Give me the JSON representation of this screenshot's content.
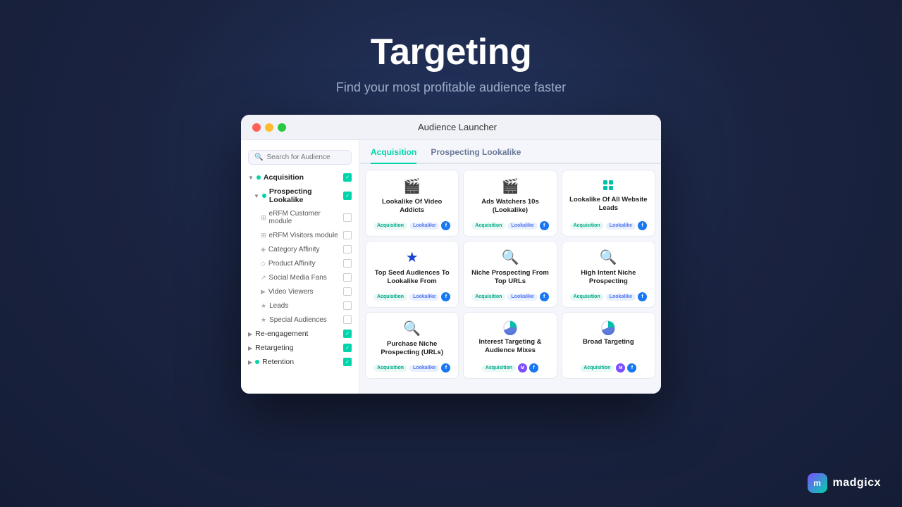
{
  "hero": {
    "title": "Targeting",
    "subtitle": "Find your most profitable audience faster"
  },
  "window": {
    "title": "Audience Launcher"
  },
  "search": {
    "placeholder": "Search for Audience"
  },
  "sidebar": {
    "items": [
      {
        "label": "Acquisition",
        "level": 0,
        "checked": true,
        "hasDot": true,
        "dotColor": "teal"
      },
      {
        "label": "Prospecting Lookalike",
        "level": 1,
        "checked": true,
        "hasDot": true,
        "dotColor": "teal"
      },
      {
        "label": "eRFM Customer module",
        "level": 2,
        "checked": false,
        "hasDot": true,
        "dotColor": "gray"
      },
      {
        "label": "eRFM Visitors module",
        "level": 2,
        "checked": false,
        "hasDot": true,
        "dotColor": "gray"
      },
      {
        "label": "Category Affinity",
        "level": 2,
        "checked": false,
        "hasDot": true,
        "dotColor": "gray"
      },
      {
        "label": "Product Affinity",
        "level": 2,
        "checked": false,
        "hasDot": true,
        "dotColor": "gray"
      },
      {
        "label": "Social Media Fans",
        "level": 2,
        "checked": false,
        "hasDot": true,
        "dotColor": "gray"
      },
      {
        "label": "Video Viewers",
        "level": 2,
        "checked": false,
        "hasDot": true,
        "dotColor": "gray"
      },
      {
        "label": "Leads",
        "level": 2,
        "checked": false,
        "hasDot": true,
        "dotColor": "gray"
      },
      {
        "label": "Special Audiences",
        "level": 2,
        "checked": false,
        "hasDot": true,
        "dotColor": "gray"
      },
      {
        "label": "Re-engagement",
        "level": 0,
        "checked": true,
        "hasDot": false,
        "collapsed": true
      },
      {
        "label": "Retargeting",
        "level": 0,
        "checked": true,
        "hasDot": false,
        "collapsed": true
      },
      {
        "label": "Retention",
        "level": 0,
        "checked": true,
        "hasDot": true,
        "dotColor": "teal",
        "collapsed": true
      }
    ]
  },
  "tabs": [
    {
      "label": "Acquisition",
      "active": true
    },
    {
      "label": "Prospecting Lookalike",
      "active": false
    }
  ],
  "cards": [
    {
      "icon": "video",
      "title": "Lookalike Of Video Addicts",
      "tags": [
        "Acquisition",
        "Lookalike"
      ],
      "hasFb": true
    },
    {
      "icon": "video",
      "title": "Ads Watchers 10s (Lookalike)",
      "tags": [
        "Acquisition",
        "Lookalike"
      ],
      "hasFb": true
    },
    {
      "icon": "brand",
      "title": "Lookalike Of All Website Leads",
      "tags": [
        "Acquisition",
        "Lookalike"
      ],
      "hasFb": true
    },
    {
      "icon": "star",
      "title": "Top Seed Audiences To Lookalike From",
      "tags": [
        "Acquisition",
        "Lookalike"
      ],
      "hasFb": true
    },
    {
      "icon": "search",
      "title": "Niche Prospecting From Top URLs",
      "tags": [
        "Acquisition",
        "Lookalike"
      ],
      "hasFb": true
    },
    {
      "icon": "search",
      "title": "High Intent Niche Prospecting",
      "tags": [
        "Acquisition",
        "Lookalike"
      ],
      "hasFb": true
    },
    {
      "icon": "search",
      "title": "Purchase Niche Prospecting (URLs)",
      "tags": [
        "Acquisition",
        "Lookalike"
      ],
      "hasFb": true
    },
    {
      "icon": "pie",
      "title": "Interest Targeting & Audience Mixes",
      "tags": [
        "Acquisition"
      ],
      "hasFb": true,
      "hasMad": true
    },
    {
      "icon": "pie",
      "title": "Broad Targeting",
      "tags": [
        "Acquisition"
      ],
      "hasFb": true,
      "hasMad": true
    }
  ],
  "madgicx": {
    "text": "madgicx"
  }
}
